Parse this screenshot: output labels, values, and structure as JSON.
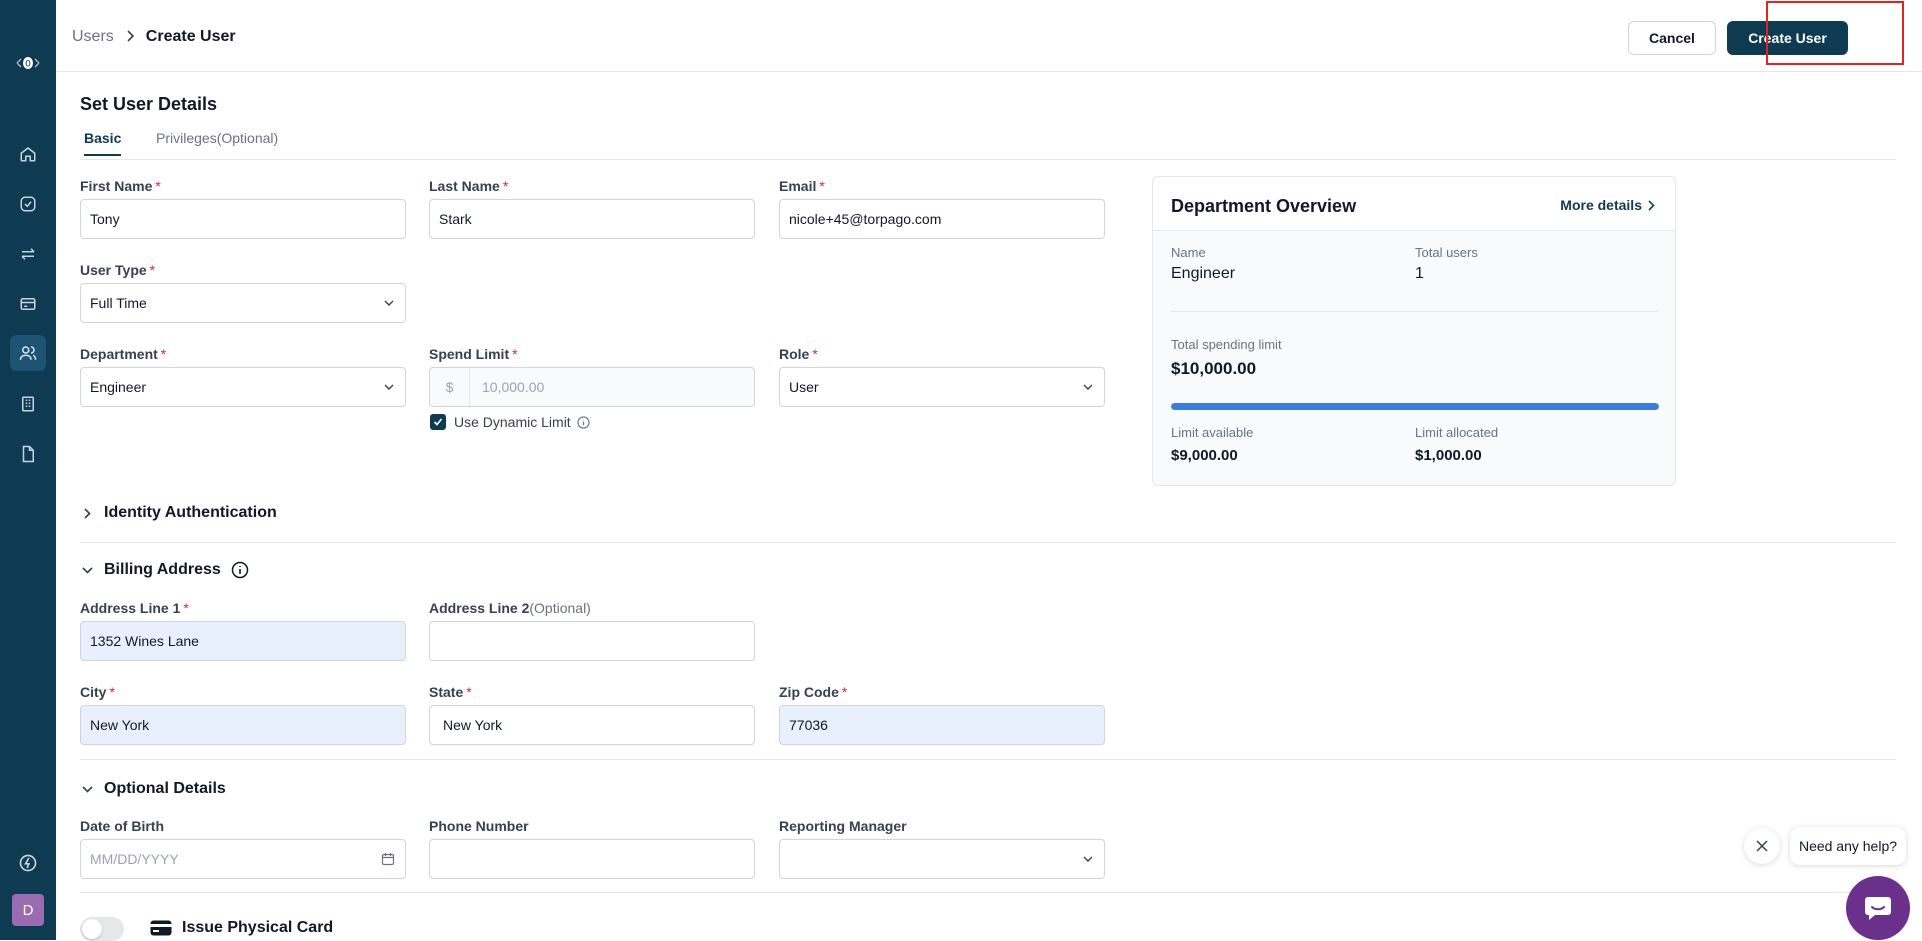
{
  "header": {
    "breadcrumb_parent": "Users",
    "breadcrumb_current": "Create User",
    "cancel_label": "Cancel",
    "create_label": "Create User"
  },
  "page": {
    "title": "Set User Details",
    "tabs": [
      {
        "label": "Basic",
        "active": true
      },
      {
        "label": "Privileges(Optional)",
        "active": false
      }
    ]
  },
  "form": {
    "first_name": {
      "label": "First Name",
      "value": "Tony"
    },
    "last_name": {
      "label": "Last Name",
      "value": "Stark"
    },
    "email": {
      "label": "Email",
      "value": "nicole+45@torpago.com"
    },
    "user_type": {
      "label": "User Type",
      "value": "Full Time"
    },
    "department": {
      "label": "Department",
      "value": "Engineer"
    },
    "spend_limit": {
      "label": "Spend Limit",
      "currency": "$",
      "placeholder": "10,000.00"
    },
    "role": {
      "label": "Role",
      "value": "User"
    },
    "dynamic_limit": {
      "label": "Use Dynamic Limit",
      "checked": true
    }
  },
  "department_overview": {
    "title": "Department Overview",
    "more_details": "More details",
    "name_label": "Name",
    "name_value": "Engineer",
    "total_users_label": "Total users",
    "total_users_value": "1",
    "total_spending_label": "Total spending limit",
    "total_spending_value": "$10,000.00",
    "limit_used_fraction": 1.0,
    "limit_available_label": "Limit available",
    "limit_available_value": "$9,000.00",
    "limit_allocated_label": "Limit allocated",
    "limit_allocated_value": "$1,000.00"
  },
  "sections": {
    "identity": {
      "title": "Identity Authentication",
      "expanded": false
    },
    "billing": {
      "title": "Billing Address",
      "expanded": true
    },
    "optional": {
      "title": "Optional Details",
      "expanded": true
    }
  },
  "billing": {
    "address1": {
      "label": "Address Line 1",
      "value": "1352 Wines Lane"
    },
    "address2": {
      "label": "Address Line 2",
      "optional_tag": "(Optional)",
      "value": ""
    },
    "city": {
      "label": "City",
      "value": "New York"
    },
    "state": {
      "label": "State",
      "value": "New York"
    },
    "zip": {
      "label": "Zip Code",
      "value": "77036"
    }
  },
  "optional": {
    "dob": {
      "label": "Date of Birth",
      "placeholder": "MM/DD/YYYY"
    },
    "phone": {
      "label": "Phone Number",
      "value": ""
    },
    "manager": {
      "label": "Reporting Manager",
      "value": ""
    }
  },
  "physical_card": {
    "label": "Issue Physical Card",
    "enabled": false
  },
  "help": {
    "bubble_text": "Need any help?"
  },
  "sidebar": {
    "logo_text": "0",
    "avatar_initial": "D",
    "items": [
      "home-icon",
      "check-circle-icon",
      "transfer-icon",
      "card-icon",
      "users-icon",
      "building-icon",
      "document-icon"
    ]
  },
  "colors": {
    "sidebar_bg": "#0e3a52",
    "primary": "#0e3a52",
    "progress": "#3b7ddd",
    "required": "#dc2626",
    "help_fab": "#6b2f8c"
  }
}
